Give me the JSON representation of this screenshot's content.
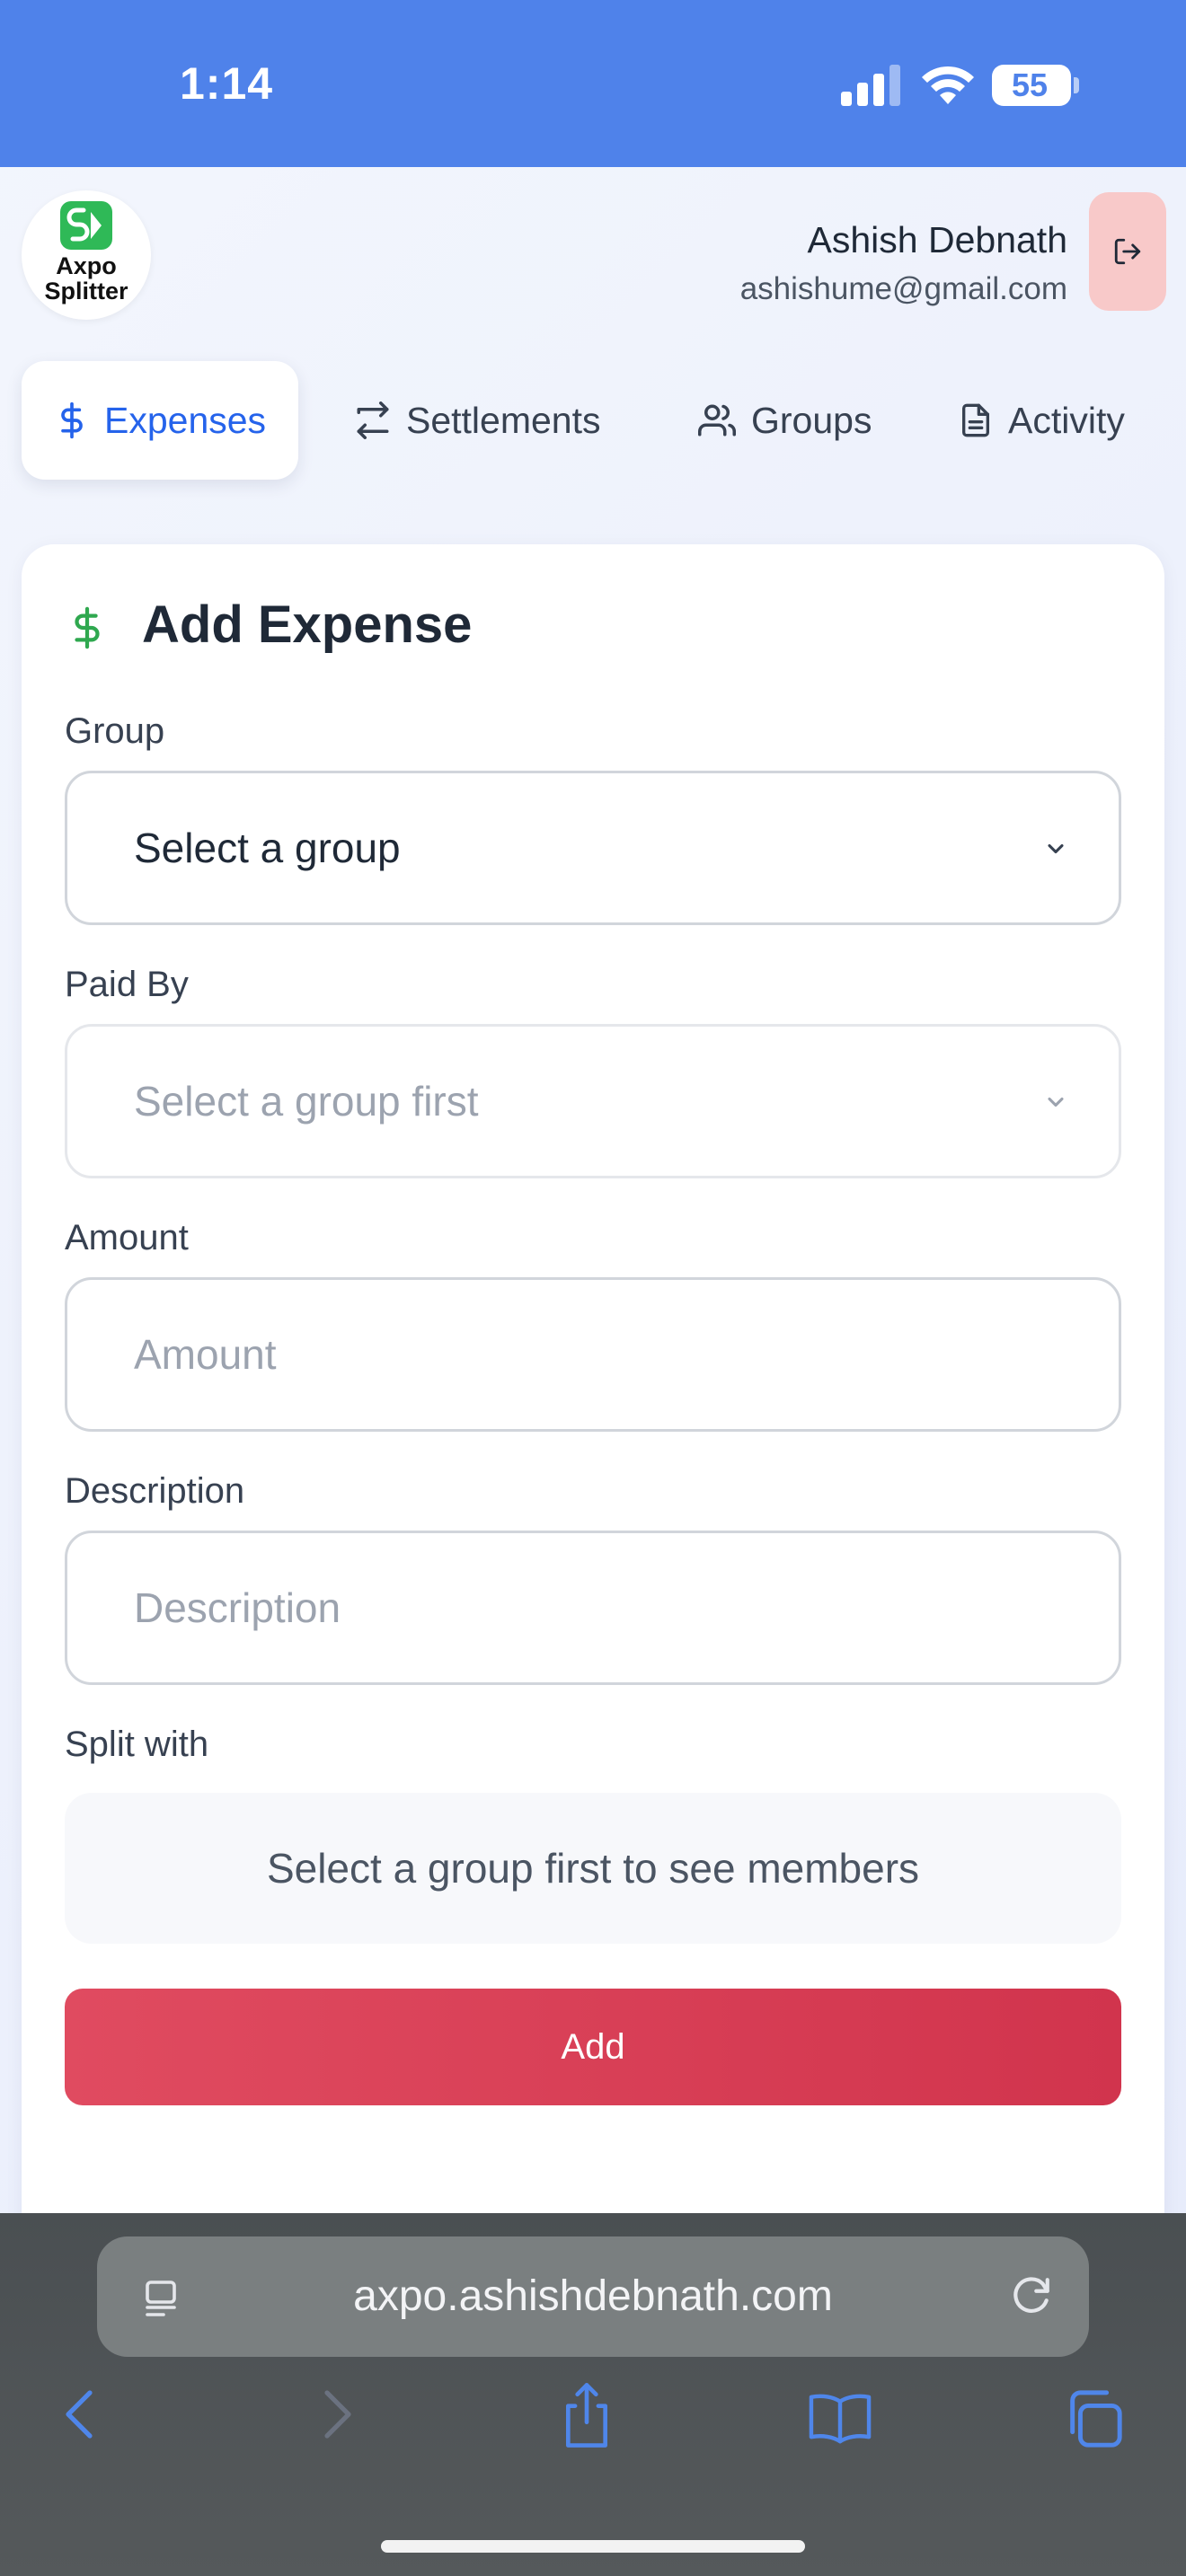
{
  "status_bar": {
    "time": "1:14",
    "battery": "55"
  },
  "app": {
    "logo_line1": "Axpo",
    "logo_line2": "Splitter",
    "brand_color": "#2fb957"
  },
  "user": {
    "name": "Ashish Debnath",
    "email": "ashishume@gmail.com"
  },
  "tabs": [
    {
      "label": "Expenses",
      "icon": "dollar-icon",
      "active": true
    },
    {
      "label": "Settlements",
      "icon": "swap-arrows-icon",
      "active": false
    },
    {
      "label": "Groups",
      "icon": "users-icon",
      "active": false
    },
    {
      "label": "Activity",
      "icon": "document-icon",
      "active": false
    }
  ],
  "form": {
    "title": "Add Expense",
    "group_label": "Group",
    "group_value": "Select a group",
    "paid_by_label": "Paid By",
    "paid_by_value": "Select a group first",
    "amount_label": "Amount",
    "amount_placeholder": "Amount",
    "description_label": "Description",
    "description_placeholder": "Description",
    "split_label": "Split with",
    "split_empty": "Select a group first to see members",
    "submit_label": "Add"
  },
  "browser": {
    "url": "axpo.ashishdebnath.com"
  },
  "colors": {
    "status_bar": "#4f82ea",
    "accent_blue": "#2563eb",
    "add_button": "#d9405a",
    "logout_bg": "#f8c9c9"
  }
}
